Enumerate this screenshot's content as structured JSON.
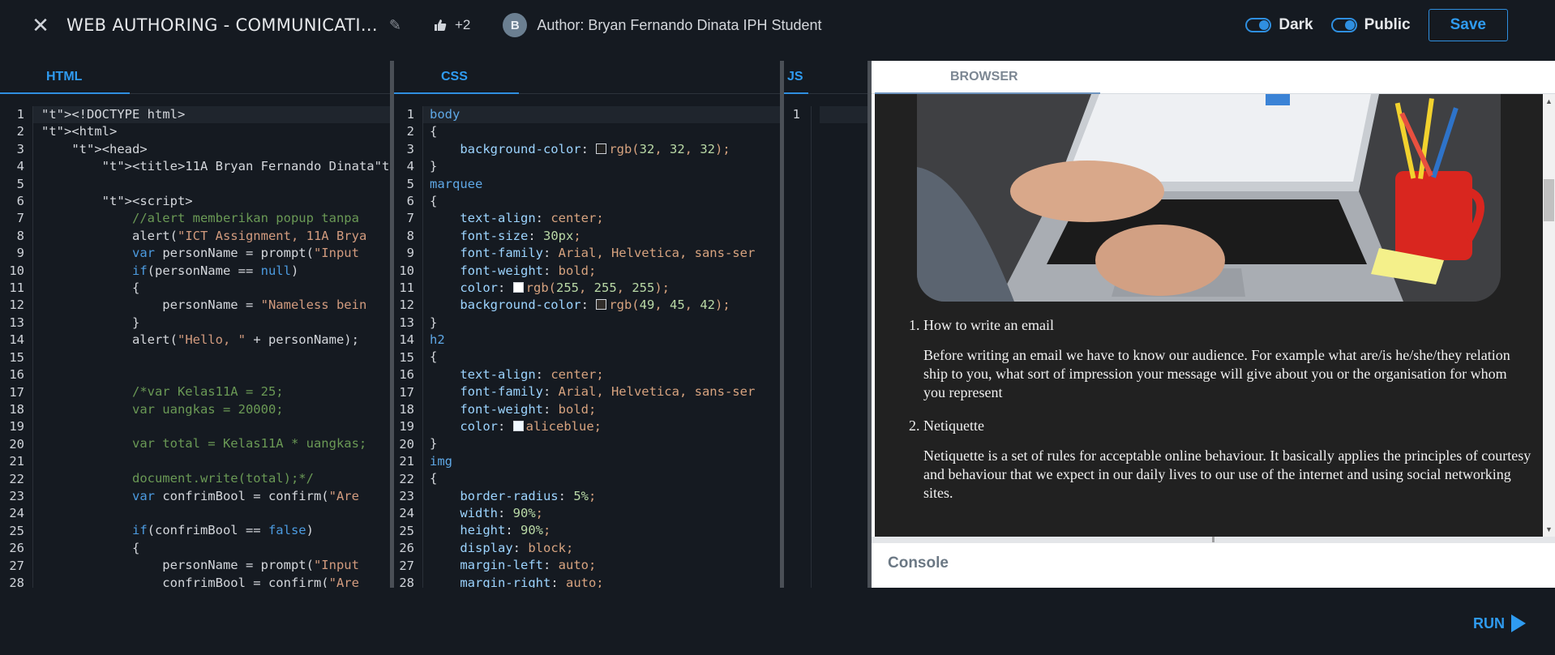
{
  "header": {
    "close_label": "✕",
    "title": "WEB AUTHORING - COMMUNICATI...",
    "likes": "+2",
    "avatar_initial": "B",
    "author": "Author: Bryan Fernando Dinata IPH Student",
    "toggle_dark": "Dark",
    "toggle_public": "Public",
    "save_label": "Save"
  },
  "tabs": {
    "html": "HTML",
    "css": "CSS",
    "js": "JS",
    "browser": "BROWSER",
    "console": "Console",
    "run": "RUN"
  },
  "html_lines": [
    "<!DOCTYPE html>",
    "<html>",
    "    <head>",
    "        <title>11A Bryan Fernando Dinata</t",
    "",
    "        <script>",
    "            //alert memberikan popup tanpa",
    "            alert(\"ICT Assignment, 11A Brya",
    "            var personName = prompt(\"Input",
    "            if(personName == null)",
    "            {",
    "                personName = \"Nameless bein",
    "            }",
    "            alert(\"Hello, \" + personName);",
    "",
    "",
    "            /*var Kelas11A = 25;",
    "            var uangkas = 20000;",
    "",
    "            var total = Kelas11A * uangkas;",
    "",
    "            document.write(total);*/",
    "            var confrimBool = confirm(\"Are",
    "",
    "            if(confrimBool == false)",
    "            {",
    "                personName = prompt(\"Input",
    "                confrimBool = confirm(\"Are"
  ],
  "css_lines": [
    "body",
    "{",
    "    background-color: rgb(32, 32, 32);",
    "}",
    "marquee",
    "{",
    "    text-align: center;",
    "    font-size: 30px;",
    "    font-family: Arial, Helvetica, sans-ser",
    "    font-weight: bold;",
    "    color: rgb(255, 255, 255);",
    "    background-color: rgb(49, 45, 42);",
    "}",
    "h2",
    "{",
    "    text-align: center;",
    "    font-family: Arial, Helvetica, sans-ser",
    "    font-weight: bold;",
    "    color: aliceblue;",
    "}",
    "img",
    "{",
    "    border-radius: 5%;",
    "    width: 90%;",
    "    height: 90%;",
    "    display: block;",
    "    margin-left: auto;",
    "    margin-right: auto;"
  ],
  "line_numbers": [
    "1",
    "2",
    "3",
    "4",
    "5",
    "6",
    "7",
    "8",
    "9",
    "10",
    "11",
    "12",
    "13",
    "14",
    "15",
    "16",
    "17",
    "18",
    "19",
    "20",
    "21",
    "22",
    "23",
    "24",
    "25",
    "26",
    "27",
    "28"
  ],
  "js_line_numbers": [
    "1"
  ],
  "browser": {
    "item1_title": "How to write an email",
    "item1_body": "Before writing an email we have to know our audience. For example what are/is he/she/they relation ship to you, what sort of impression your message will give about you or the organisation for whom you represent",
    "item2_title": "Netiquette",
    "item2_body": "Netiquette is a set of rules for acceptable online behaviour. It basically applies the principles of courtesy and behaviour that we expect in our daily lives to our use of the internet and using social networking sites.",
    "image_desc_icon": "laptop-photo"
  },
  "colors": {
    "accent": "#2f9bf0",
    "editor_bg": "#151a21",
    "preview_bg": "#212121"
  }
}
